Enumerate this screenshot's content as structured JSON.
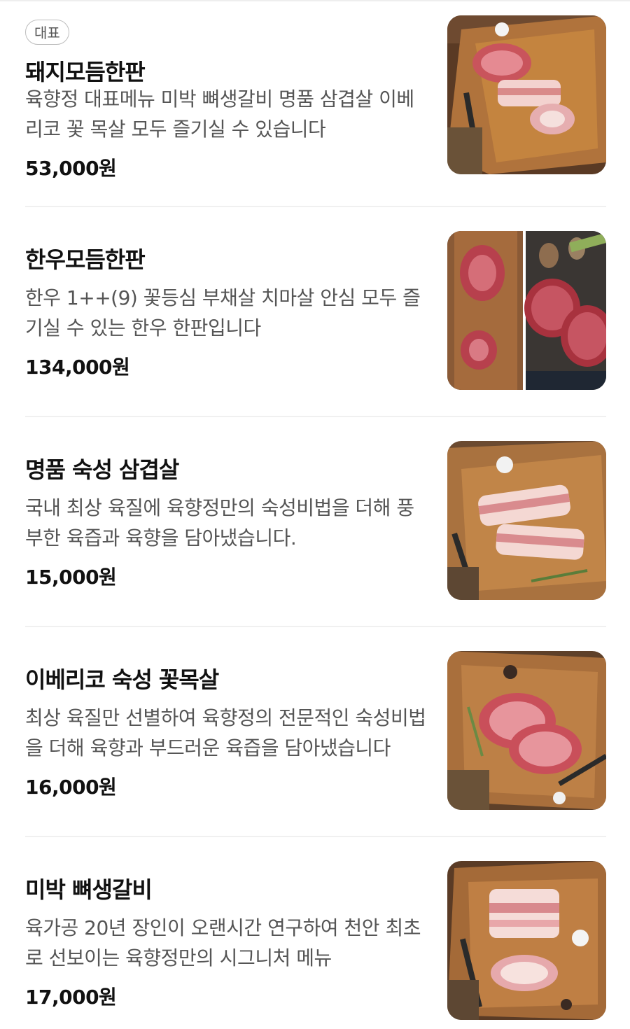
{
  "menu": {
    "items": [
      {
        "badge": "대표",
        "name": "돼지모듬한판",
        "description": "육향정 대표메뉴 미박 뼈생갈비 명품 삼겹살 이베리코 꽃 목살 모두 즐기실 수 있습니다",
        "price": "53,000원",
        "image_icon": "pork-platter-image"
      },
      {
        "name": "한우모듬한판",
        "description": "한우 1++(9) 꽃등심 부채살 치마살 안심 모두 즐기실 수 있는 한우 한판입니다",
        "price": "134,000원",
        "image_icon": "hanwoo-platter-image"
      },
      {
        "name": "명품 숙성 삼겹살",
        "description": "국내 최상 육질에 육향정만의 숙성비법을 더해 풍부한 육즙과 육향을 담아냈습니다.",
        "price": "15,000원",
        "image_icon": "pork-belly-image"
      },
      {
        "name": "이베리코 숙성 꽃목살",
        "description": "최상 육질만 선별하여 육향정의 전문적인 숙성비법을 더해 육향과 부드러운 육즙을 담아냈습니다",
        "price": "16,000원",
        "image_icon": "iberico-neck-image"
      },
      {
        "name": "미박 뼈생갈비",
        "description": "육가공 20년 장인이 오랜시간 연구하여 천안 최초로 선보이는 육향정만의 시그니처 메뉴",
        "price": "17,000원",
        "image_icon": "bone-rib-image"
      }
    ]
  }
}
